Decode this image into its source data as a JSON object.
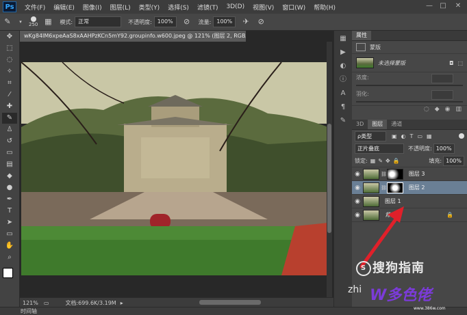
{
  "app": {
    "logo": "Ps"
  },
  "menu": [
    "文件(F)",
    "编辑(E)",
    "图像(I)",
    "图层(L)",
    "类型(Y)",
    "选择(S)",
    "滤镜(T)",
    "3D(D)",
    "视图(V)",
    "窗口(W)",
    "帮助(H)"
  ],
  "window_controls": [
    "—",
    "□",
    "✕"
  ],
  "options": {
    "brush_size": "250",
    "mode_label": "模式:",
    "mode_value": "正常",
    "opacity_label": "不透明度:",
    "opacity_value": "100%",
    "flow_label": "流量:",
    "flow_value": "100%"
  },
  "document": {
    "tab_title": "wKg84IM6xpeAaS8xAAHPzKCn5mY92.groupinfo.w600.jpeg @ 121% (图层 2, RGB/8#) *",
    "zoom": "121%",
    "doc_info": "文档:699.6K/3.19M"
  },
  "timeline_label": "时间轴",
  "properties": {
    "tab": "属性",
    "section": "蒙版",
    "item_label": "未选择蒙版",
    "density_label": "浓度:",
    "feather_label": "羽化:"
  },
  "layers_panel": {
    "tabs": [
      "3D",
      "图层",
      "通道"
    ],
    "filter_label": "ρ类型",
    "blend_mode": "正片叠底",
    "opacity_label": "不透明度:",
    "opacity_value": "100%",
    "lock_label": "锁定:",
    "fill_label": "填充:",
    "fill_value": "100%",
    "layers": [
      {
        "name": "图层 3",
        "selected": false,
        "has_mask": true
      },
      {
        "name": "图层 2",
        "selected": true,
        "has_mask": true
      },
      {
        "name": "图层 1",
        "selected": false,
        "has_mask": false
      },
      {
        "name": "背景",
        "selected": false,
        "has_mask": false
      }
    ]
  },
  "watermark": {
    "text1": "搜狗指南",
    "prefix": "zhi",
    "text2": "W多色佬",
    "site": "www.386w.com"
  },
  "colors": {
    "accent": "#6a7f95",
    "arrow": "#e0202a"
  }
}
